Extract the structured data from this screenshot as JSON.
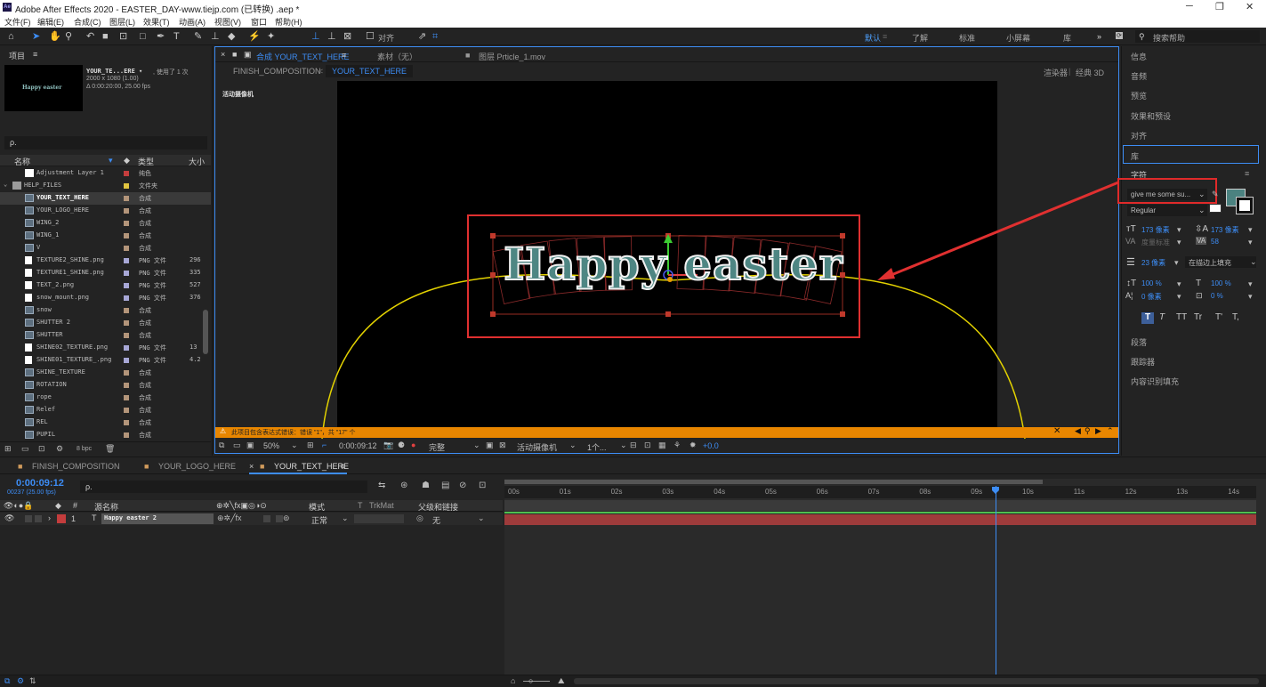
{
  "window": {
    "title": "Adobe After Effects 2020 - EASTER_DAY-www.tiejp.com (已转换) .aep *",
    "app_icon": "Ae"
  },
  "menu": [
    "文件(F)",
    "编辑(E)",
    "合成(C)",
    "图层(L)",
    "效果(T)",
    "动画(A)",
    "视图(V)",
    "窗口",
    "帮助(H)"
  ],
  "toolbar": {
    "align_label": "对齐",
    "workspaces": [
      "默认",
      "了解",
      "标准",
      "小屏幕",
      "库"
    ],
    "search_placeholder": "搜索帮助"
  },
  "project": {
    "title": "项目",
    "comp_name": "YOUR_TE...ERE ▾",
    "usage": ", 使用了 1 次",
    "dims": "2000 x 1080 (1.00)",
    "duration": "Δ 0:00:20:00, 25.00 fps",
    "thumb_text": "Happy easter",
    "search_placeholder": "ρ.",
    "col_name": "名称",
    "col_type": "类型",
    "col_size": "大小",
    "bpc": "8 bpc",
    "items": [
      {
        "name": "Adjustment Layer 1",
        "type": "纯色",
        "size": "",
        "color": "#c43d3d",
        "kind": "solid"
      },
      {
        "name": "HELP_FILES",
        "type": "文件夹",
        "size": "",
        "color": "#e0c440",
        "kind": "folder"
      },
      {
        "name": "YOUR_TEXT_HERE",
        "type": "合成",
        "size": "",
        "color": "#b3957a",
        "kind": "comp"
      },
      {
        "name": "YOUR_LOGO_HERE",
        "type": "合成",
        "size": "",
        "color": "#b3957a",
        "kind": "comp"
      },
      {
        "name": "WING_2",
        "type": "合成",
        "size": "",
        "color": "#b3957a",
        "kind": "comp"
      },
      {
        "name": "WING_1",
        "type": "合成",
        "size": "",
        "color": "#b3957a",
        "kind": "comp"
      },
      {
        "name": "V",
        "type": "合成",
        "size": "",
        "color": "#b3957a",
        "kind": "comp"
      },
      {
        "name": "TEXTURE2_SHINE.png",
        "type": "PNG 文件",
        "size": "296",
        "color": "#a7a7d6",
        "kind": "file"
      },
      {
        "name": "TEXTURE1_SHINE.png",
        "type": "PNG 文件",
        "size": "335",
        "color": "#a7a7d6",
        "kind": "file"
      },
      {
        "name": "TEXT_2.png",
        "type": "PNG 文件",
        "size": "527",
        "color": "#a7a7d6",
        "kind": "file"
      },
      {
        "name": "snow_mount.png",
        "type": "PNG 文件",
        "size": "376",
        "color": "#a7a7d6",
        "kind": "file"
      },
      {
        "name": "snow",
        "type": "合成",
        "size": "",
        "color": "#b3957a",
        "kind": "comp"
      },
      {
        "name": "SHUTTER 2",
        "type": "合成",
        "size": "",
        "color": "#b3957a",
        "kind": "comp"
      },
      {
        "name": "SHUTTER",
        "type": "合成",
        "size": "",
        "color": "#b3957a",
        "kind": "comp"
      },
      {
        "name": "SHINE02_TEXTURE.png",
        "type": "PNG 文件",
        "size": "13",
        "color": "#a7a7d6",
        "kind": "file"
      },
      {
        "name": "SHINE01_TEXTURE_.png",
        "type": "PNG 文件",
        "size": "4.2",
        "color": "#a7a7d6",
        "kind": "file"
      },
      {
        "name": "SHINE_TEXTURE",
        "type": "合成",
        "size": "",
        "color": "#b3957a",
        "kind": "comp"
      },
      {
        "name": "ROTATION",
        "type": "合成",
        "size": "",
        "color": "#b3957a",
        "kind": "comp"
      },
      {
        "name": "rope",
        "type": "合成",
        "size": "",
        "color": "#b3957a",
        "kind": "comp"
      },
      {
        "name": "Relef",
        "type": "合成",
        "size": "",
        "color": "#b3957a",
        "kind": "comp"
      },
      {
        "name": "REL",
        "type": "合成",
        "size": "",
        "color": "#b3957a",
        "kind": "comp"
      },
      {
        "name": "PUPIL",
        "type": "合成",
        "size": "",
        "color": "#b3957a",
        "kind": "comp"
      }
    ]
  },
  "viewer": {
    "tab_comp": "合成 YOUR_TEXT_HERE",
    "tab_footage": "素材（无）",
    "tab_layer": "图层 Prticle_1.mov",
    "breadcrumb_1": "FINISH_COMPOSITION",
    "breadcrumb_2": "YOUR_TEXT_HERE",
    "renderer": "渲染器",
    "renderer_mode": "经典 3D",
    "camera_label": "活动摄像机",
    "canvas_text": "Happy easter",
    "warning": "此项目包含表达式错误：错误 \"1\"，共 \"17\" 个",
    "zoom": "50%",
    "timecode": "0:00:09:12",
    "quality": "完整",
    "camera": "活动摄像机",
    "views": "1个...",
    "exposure": "+0.0"
  },
  "right_panel": {
    "items": [
      "信息",
      "音频",
      "预览",
      "效果和预设",
      "对齐",
      "库"
    ],
    "char_title": "字符",
    "font": "give me some su...",
    "style": "Regular",
    "font_size": "173 像素",
    "leading": "173 像素",
    "kerning": "度量标准",
    "tracking": "58",
    "stroke_width": "23 像素",
    "stroke_mode": "在描边上填充",
    "vscale": "100 %",
    "hscale": "100 %",
    "baseline": "0 像素",
    "tsume": "0 %",
    "type_buttons": [
      "T",
      "T",
      "TT",
      "Tr",
      "T'",
      "T,"
    ],
    "after_items": [
      "段落",
      "跟踪器",
      "内容识别填充"
    ],
    "fill_color": "#4b8280"
  },
  "timeline": {
    "tabs": [
      "FINISH_COMPOSITION",
      "YOUR_LOGO_HERE",
      "YOUR_TEXT_HERE"
    ],
    "timecode": "0:00:09:12",
    "frame_info": "00237 (25.00 fps)",
    "search_placeholder": "ρ.",
    "col_layer": "源名称",
    "col_mode": "模式",
    "col_trkmat": "TrkMat",
    "col_parent": "父级和链接",
    "layer_num": "1",
    "layer_name": "Happy easter 2",
    "layer_mode": "正常",
    "layer_parent": "无",
    "ticks": [
      "00s",
      "01s",
      "02s",
      "03s",
      "04s",
      "05s",
      "06s",
      "07s",
      "08s",
      "09s",
      "10s",
      "11s",
      "12s",
      "13s",
      "14s"
    ],
    "playhead_seconds": 9.48,
    "layer_color": "#9e3b3b"
  }
}
